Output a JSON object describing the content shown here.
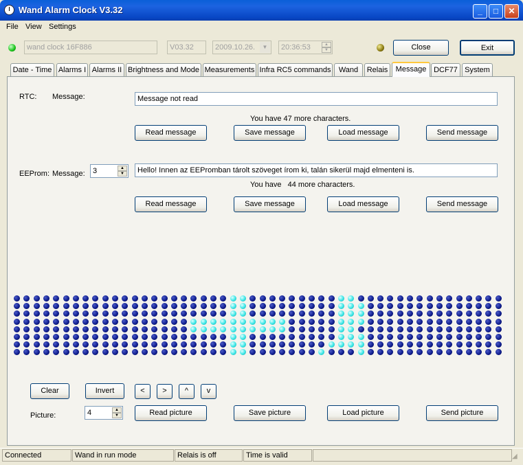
{
  "window": {
    "title": "Wand Alarm Clock V3.32"
  },
  "menu": [
    "File",
    "View",
    "Settings"
  ],
  "toolbar": {
    "device_name": "wand clock 16F886",
    "version": "V03.32",
    "date": "2009.10.26.",
    "time": "20:36:53",
    "close_label": "Close",
    "exit_label": "Exit",
    "connection_led_color": "#19c419",
    "status_led_color": "#8a7a10"
  },
  "tabs": [
    {
      "label": "Date - Time"
    },
    {
      "label": "Alarms I"
    },
    {
      "label": "Alarms II"
    },
    {
      "label": "Brightness and Mode"
    },
    {
      "label": "Measurements"
    },
    {
      "label": "Infra RC5 commands"
    },
    {
      "label": "Wand"
    },
    {
      "label": "Relais"
    },
    {
      "label": "Message",
      "active": true
    },
    {
      "label": "DCF77"
    },
    {
      "label": "System"
    }
  ],
  "rtc": {
    "section_label": "RTC:",
    "message_label": "Message:",
    "message_value": "Message not read",
    "chars_info": "You have 47 more characters.",
    "read_label": "Read message",
    "save_label": "Save message",
    "load_label": "Load message",
    "send_label": "Send message"
  },
  "eeprom": {
    "section_label": "EEProm:",
    "message_label": "Message:",
    "index_value": "3",
    "message_value": "Hello! Innen az EEPromban tárolt szöveget írom ki, talán sikerül majd elmenteni is.",
    "chars_info": "You have   44 more characters.",
    "read_label": "Read message",
    "save_label": "Save message",
    "load_label": "Load message",
    "send_label": "Send message"
  },
  "matrix": {
    "rows": 8,
    "cols": 50,
    "on_color": "#3ae6e6",
    "off_color": "#0c1a8a",
    "lit_pixels": [
      [
        0,
        22
      ],
      [
        0,
        23
      ],
      [
        1,
        22
      ],
      [
        1,
        23
      ],
      [
        2,
        22
      ],
      [
        2,
        23
      ],
      [
        3,
        22
      ],
      [
        3,
        23
      ],
      [
        3,
        18
      ],
      [
        3,
        19
      ],
      [
        3,
        20
      ],
      [
        3,
        21
      ],
      [
        3,
        24
      ],
      [
        3,
        25
      ],
      [
        3,
        26
      ],
      [
        3,
        27
      ],
      [
        4,
        18
      ],
      [
        4,
        19
      ],
      [
        4,
        20
      ],
      [
        4,
        21
      ],
      [
        4,
        22
      ],
      [
        4,
        23
      ],
      [
        4,
        24
      ],
      [
        4,
        25
      ],
      [
        4,
        26
      ],
      [
        4,
        27
      ],
      [
        5,
        22
      ],
      [
        5,
        23
      ],
      [
        6,
        22
      ],
      [
        6,
        23
      ],
      [
        7,
        22
      ],
      [
        7,
        23
      ],
      [
        0,
        33
      ],
      [
        0,
        34
      ],
      [
        1,
        33
      ],
      [
        1,
        34
      ],
      [
        1,
        35
      ],
      [
        2,
        33
      ],
      [
        2,
        34
      ],
      [
        2,
        35
      ],
      [
        3,
        33
      ],
      [
        3,
        34
      ],
      [
        3,
        35
      ],
      [
        4,
        33
      ],
      [
        4,
        34
      ],
      [
        5,
        33
      ],
      [
        5,
        34
      ],
      [
        5,
        35
      ],
      [
        6,
        32
      ],
      [
        6,
        33
      ],
      [
        6,
        34
      ],
      [
        6,
        35
      ],
      [
        7,
        31
      ],
      [
        7,
        35
      ]
    ]
  },
  "picture": {
    "clear_label": "Clear",
    "invert_label": "Invert",
    "left_label": "<",
    "right_label": ">",
    "up_label": "^",
    "down_label": "v",
    "picture_label": "Picture:",
    "picture_value": "4",
    "read_label": "Read picture",
    "save_label": "Save picture",
    "load_label": "Load picture",
    "send_label": "Send picture"
  },
  "status": {
    "connection": "Connected",
    "wand": "Wand in run mode",
    "relais": "Relais is off",
    "time": "Time is valid"
  }
}
